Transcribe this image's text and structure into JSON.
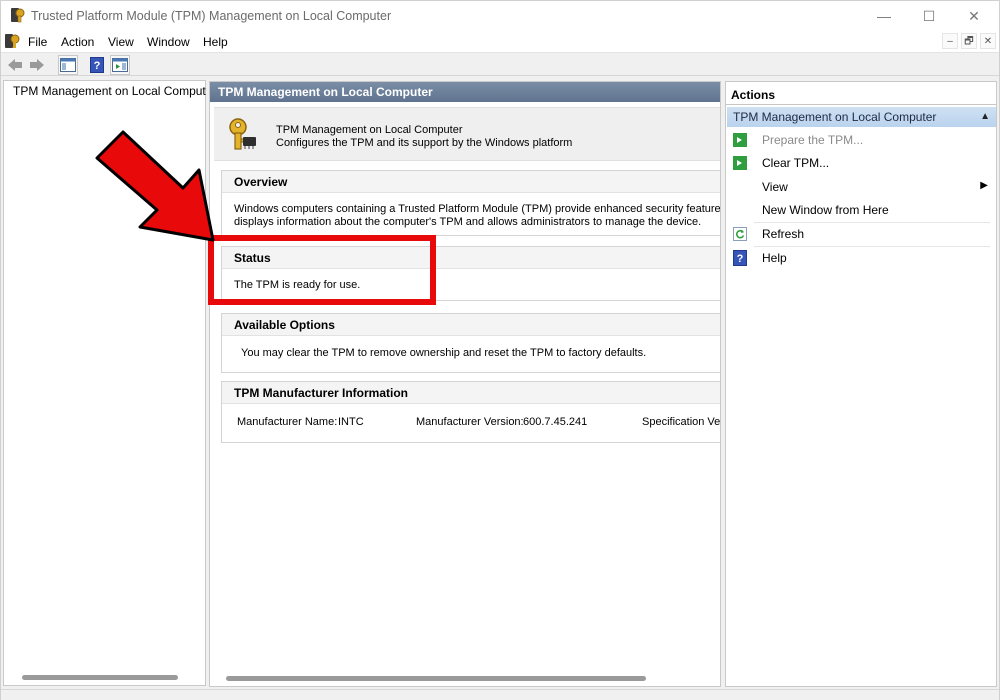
{
  "window": {
    "title": "Trusted Platform Module (TPM) Management on Local Computer",
    "controls": {
      "minimize": "—",
      "maximize": "☐",
      "close": "✕"
    }
  },
  "menubar": {
    "items": [
      "File",
      "Action",
      "View",
      "Window",
      "Help"
    ],
    "mdi_controls": {
      "minimize": "–",
      "restore": "🗗",
      "close": "✕"
    }
  },
  "toolbar": {
    "buttons": [
      "back-icon",
      "forward-icon",
      "show-hide-console-tree-icon",
      "help-icon",
      "show-hide-action-pane-icon"
    ]
  },
  "tree": {
    "root_label": "TPM Management on Local Computer"
  },
  "center": {
    "header": "TPM Management on Local Computer",
    "info_line1": "TPM Management on Local Computer",
    "info_line2": "Configures the TPM and its support by the Windows platform",
    "overview": {
      "heading": "Overview",
      "text_line1": "Windows computers containing a Trusted Platform Module (TPM) provide enhanced security features. This",
      "text_line2": "displays information about the computer's TPM and allows administrators to manage the device."
    },
    "status": {
      "heading": "Status",
      "text": "The TPM is ready for use."
    },
    "options": {
      "heading": "Available Options",
      "text": "You may clear the TPM to remove ownership and reset the TPM to factory defaults."
    },
    "manufacturer": {
      "heading": "TPM Manufacturer Information",
      "name_label": "Manufacturer Name:",
      "name_value": "INTC",
      "version_label": "Manufacturer Version:",
      "version_value": "600.7.45.241",
      "spec_label": "Specification Ver"
    }
  },
  "actions": {
    "heading": "Actions",
    "section_title": "TPM Management on Local Computer",
    "items": [
      {
        "label": "Prepare the TPM...",
        "icon": "green-arrow-icon",
        "disabled": true
      },
      {
        "label": "Clear TPM...",
        "icon": "green-arrow-icon",
        "disabled": false
      },
      {
        "label": "View",
        "icon": "",
        "disabled": false
      },
      {
        "label": "New Window from Here",
        "icon": "",
        "disabled": false
      },
      {
        "label": "Refresh",
        "icon": "refresh-icon",
        "disabled": false
      },
      {
        "label": "Help",
        "icon": "help-icon",
        "disabled": false
      }
    ]
  },
  "colors": {
    "annotation_red": "#e8090b",
    "pane_header": "#6a7e99",
    "actions_selected": "#c4d9f1"
  }
}
